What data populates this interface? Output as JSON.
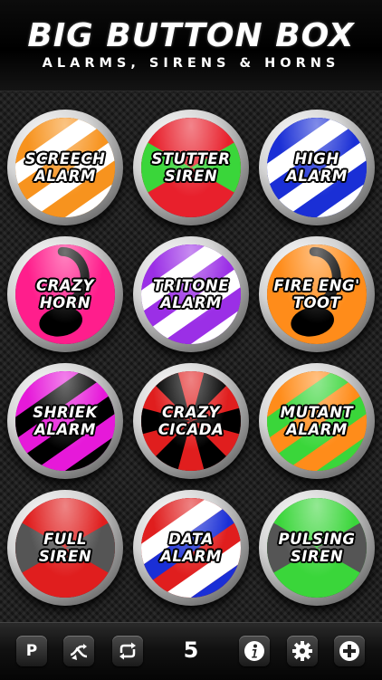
{
  "header": {
    "title": "BIG BUTTON BOX",
    "subtitle": "ALARMS, SIRENS & HORNS"
  },
  "buttons": [
    {
      "lines": [
        "SCREECH",
        "ALARM"
      ],
      "style": "stripes",
      "colors": [
        "#f7931e",
        "#ffffff"
      ]
    },
    {
      "lines": [
        "STUTTER",
        "SIREN"
      ],
      "style": "wedges2",
      "colors": [
        "#e8202c",
        "#3ad63a"
      ]
    },
    {
      "lines": [
        "HIGH",
        "ALARM"
      ],
      "style": "stripes",
      "colors": [
        "#1a2fd6",
        "#ffffff"
      ]
    },
    {
      "lines": [
        "CRAZY",
        "HORN"
      ],
      "style": "horn",
      "colors": [
        "#ff1e8c",
        "#000000"
      ]
    },
    {
      "lines": [
        "TRITONE",
        "ALARM"
      ],
      "style": "stripes",
      "colors": [
        "#9b2fe6",
        "#ffffff"
      ]
    },
    {
      "lines": [
        "FIRE ENG'",
        "TOOT"
      ],
      "style": "horn",
      "colors": [
        "#ff8c1a",
        "#000000"
      ]
    },
    {
      "lines": [
        "SHRIEK",
        "ALARM"
      ],
      "style": "stripes",
      "colors": [
        "#e619d9",
        "#000000"
      ]
    },
    {
      "lines": [
        "CRAZY",
        "CICADA"
      ],
      "style": "rays",
      "colors": [
        "#e01e1e",
        "#000000"
      ]
    },
    {
      "lines": [
        "MUTANT",
        "ALARM"
      ],
      "style": "stripes",
      "colors": [
        "#ff8c1a",
        "#3ad63a"
      ]
    },
    {
      "lines": [
        "FULL",
        "SIREN"
      ],
      "style": "wedges2",
      "colors": [
        "#e01e1e",
        "#555555"
      ]
    },
    {
      "lines": [
        "DATA",
        "ALARM"
      ],
      "style": "stripes3",
      "colors": [
        "#e01e1e",
        "#ffffff",
        "#1a2fd6"
      ]
    },
    {
      "lines": [
        "PULSING",
        "SIREN"
      ],
      "style": "wedges2",
      "colors": [
        "#3ad63a",
        "#555555"
      ]
    }
  ],
  "toolbar": {
    "p_label": "P",
    "count": "5",
    "icons": [
      "p-icon",
      "shuffle-icon",
      "repeat-icon",
      "info-icon",
      "gear-icon",
      "plus-icon"
    ]
  }
}
